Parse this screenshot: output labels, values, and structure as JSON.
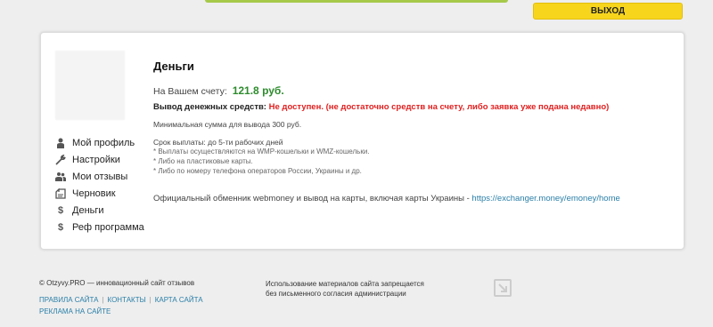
{
  "header": {
    "logout_label": "ВЫХОД",
    "accent": "#f7d51d",
    "top_bar_color": "#a6c94a"
  },
  "sidebar": {
    "items": [
      {
        "label": "Мой профиль",
        "icon": "user-icon"
      },
      {
        "label": "Настройки",
        "icon": "wrench-icon"
      },
      {
        "label": "Мои отзывы",
        "icon": "users-icon"
      },
      {
        "label": "Черновик",
        "icon": "draft-icon"
      },
      {
        "label": "Деньги",
        "icon": "dollar-icon"
      },
      {
        "label": "Реф программа",
        "icon": "dollar-icon"
      }
    ]
  },
  "main": {
    "title": "Деньги",
    "balance_label": "На Вашем счету:",
    "balance_value": "121.8 руб.",
    "withdraw_label": "Вывод денежных средств:",
    "withdraw_status": "Не доступен. (не достаточно средств на счету, либо заявка уже подана недавно)",
    "min_sum": "Минимальная сумма для вывода 300 руб.",
    "payout_terms": "Срок выплаты: до 5-ти рабочих дней",
    "notes": [
      "* Выплаты осуществляются на WMP-кошельки и WMZ-кошельки.",
      "* Либо на пластиковые карты.",
      "* Либо по номеру телефона операторов России, Украины и др."
    ],
    "exchange_text": "Официальный обменник webmoney и вывод на карты, включая карты Украины - ",
    "exchange_link": "https://exchanger.money/emoney/home",
    "balance_color": "#2e8b2e",
    "status_color": "#e02020"
  },
  "footer": {
    "copyright": "© Otzyvy.PRO — инновационный сайт отзывов",
    "links": [
      "ПРАВИЛА САЙТА",
      "КОНТАКТЫ",
      "КАРТА САЙТА",
      "РЕКЛАМА НА САЙТЕ"
    ],
    "notice_line1": "Использование материалов сайта запрещается",
    "notice_line2": "без письменного согласия администрации"
  }
}
